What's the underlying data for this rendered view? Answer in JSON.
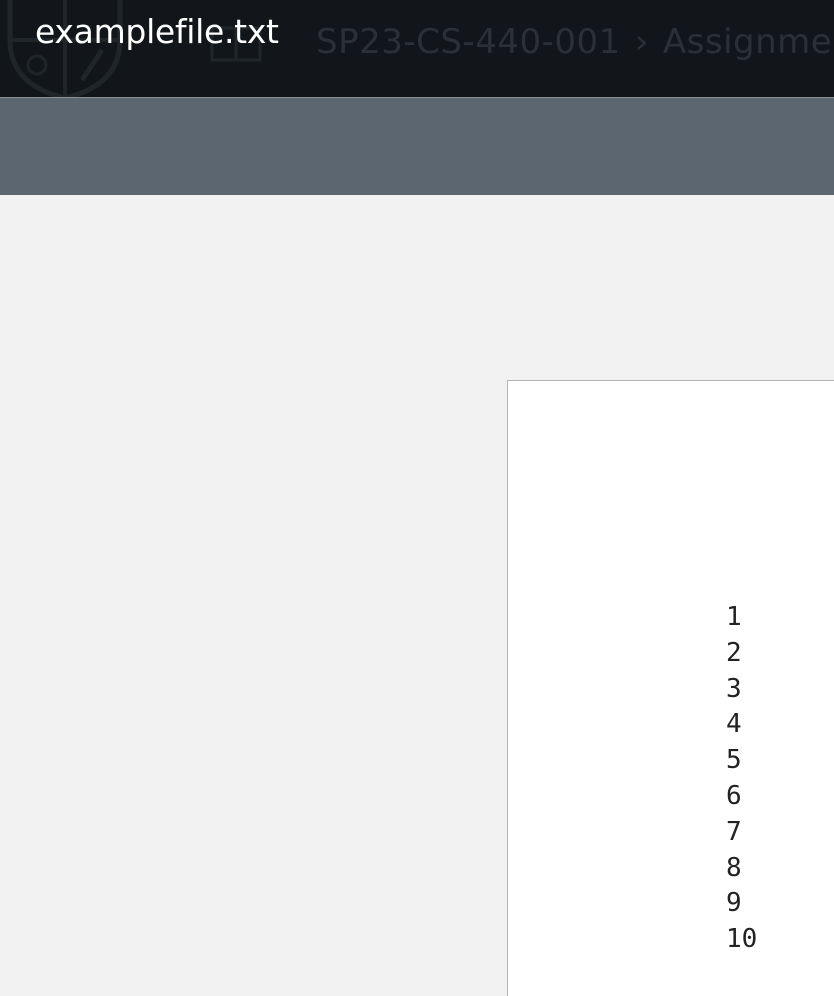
{
  "header": {
    "file_title": "examplefile.txt",
    "breadcrumb": {
      "course": "SP23-CS-440-001",
      "separator": "›",
      "section": "Assignments"
    },
    "crest_icon": "university-crest-icon",
    "background_icon": "book-icon"
  },
  "toolbar": {},
  "document": {
    "lines": [
      "1",
      "2",
      "3",
      "4",
      "5",
      "6",
      "7",
      "8",
      "9",
      "10"
    ]
  },
  "colors": {
    "header_bg": "#12161a",
    "toolbar_bg": "#5b6670",
    "viewer_bg": "#f2f2f2",
    "page_bg": "#ffffff"
  }
}
